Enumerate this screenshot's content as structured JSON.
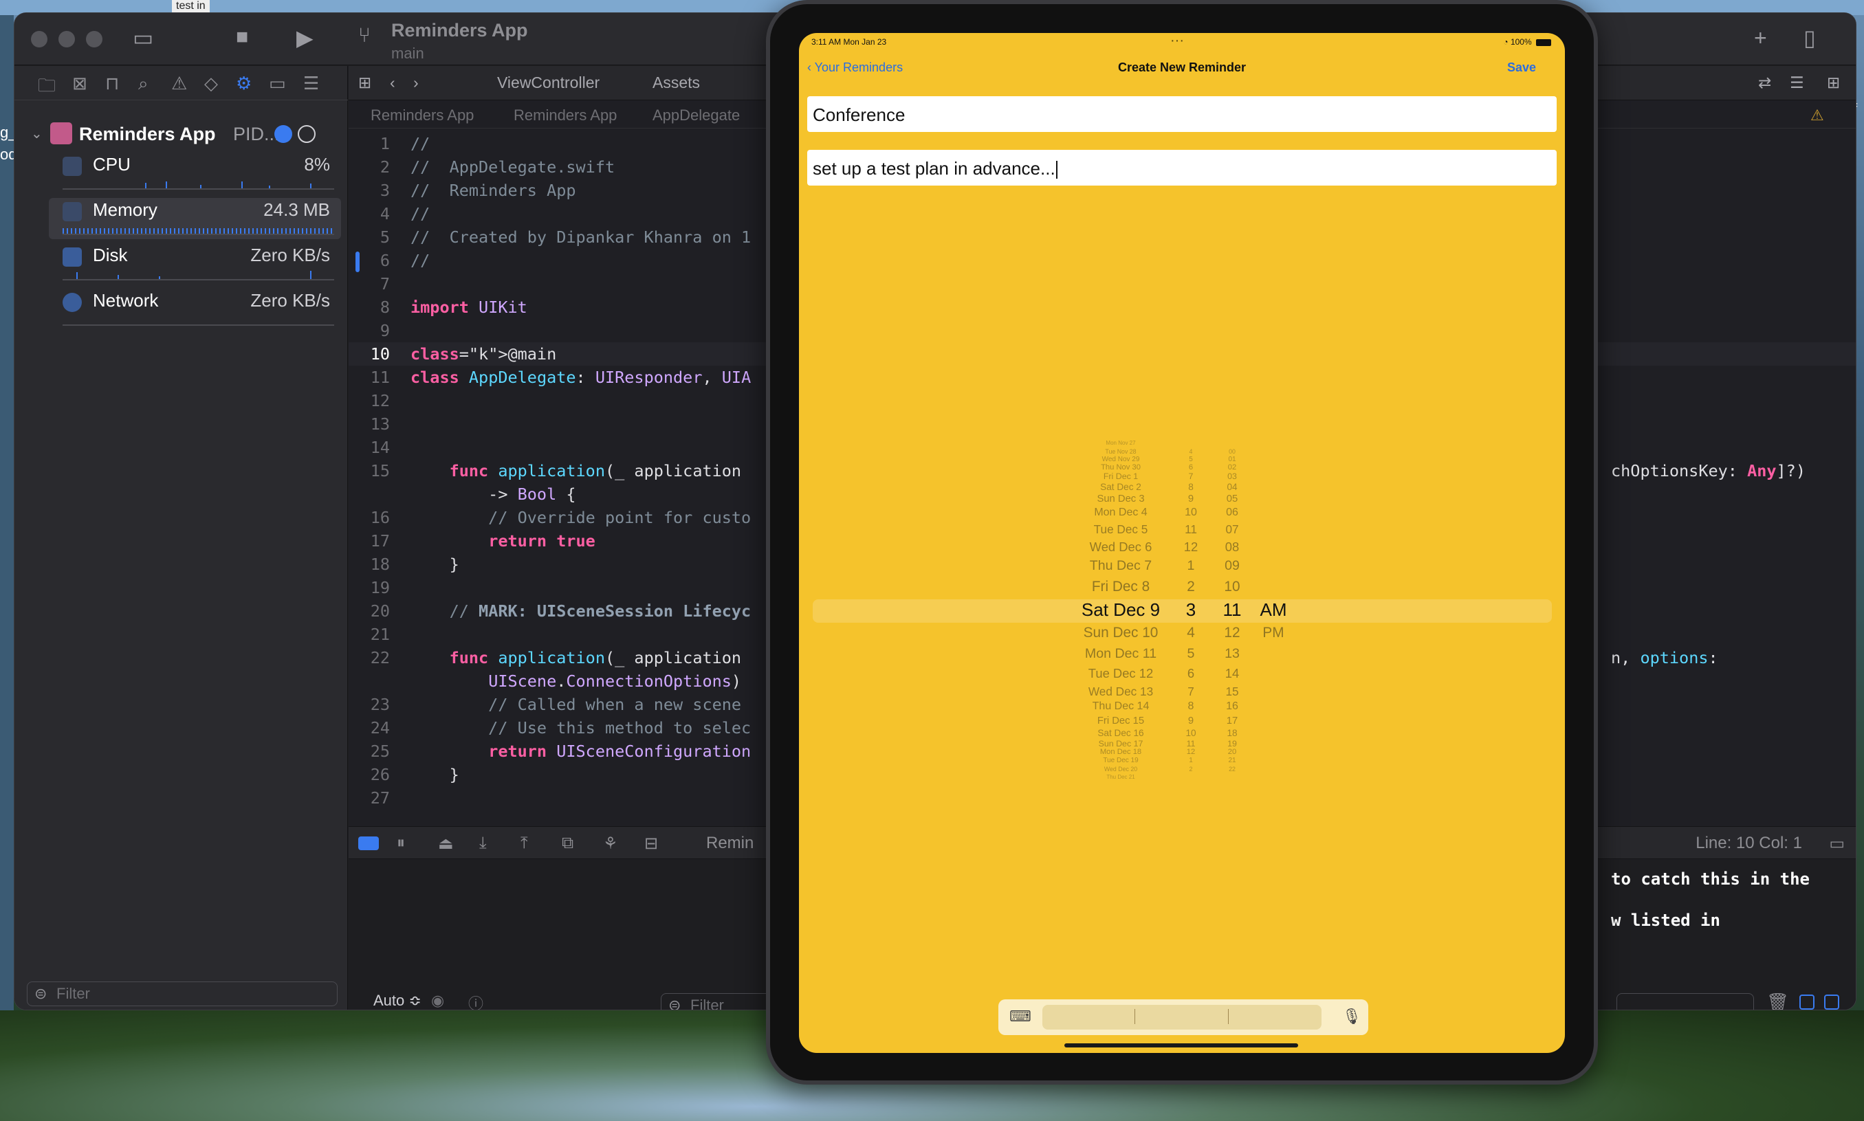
{
  "desktop": {
    "tab_text": "test in",
    "left_fragments": [
      "g_",
      "od"
    ],
    "right_fragment": "f"
  },
  "xcode": {
    "project_title": "Reminders App",
    "branch": "main",
    "jump_tabs": [
      "ViewController",
      "Assets"
    ],
    "breadcrumb": [
      "Reminders App",
      "Reminders App",
      "AppDelegate"
    ],
    "navigator": {
      "process_name": "Reminders App",
      "process_pid": "PID...",
      "gauges": [
        {
          "label": "CPU",
          "value": "8%"
        },
        {
          "label": "Memory",
          "value": "24.3 MB"
        },
        {
          "label": "Disk",
          "value": "Zero KB/s"
        },
        {
          "label": "Network",
          "value": "Zero KB/s"
        }
      ],
      "filter_placeholder": "Filter"
    },
    "code_lines": [
      {
        "n": "1",
        "text": "//"
      },
      {
        "n": "2",
        "text": "//  AppDelegate.swift"
      },
      {
        "n": "3",
        "text": "//  Reminders App"
      },
      {
        "n": "4",
        "text": "//"
      },
      {
        "n": "5",
        "text": "//  Created by Dipankar Khanra on 1"
      },
      {
        "n": "6",
        "text": "//"
      },
      {
        "n": "7",
        "text": ""
      },
      {
        "n": "8",
        "text": "import UIKit"
      },
      {
        "n": "9",
        "text": ""
      },
      {
        "n": "10",
        "text": "@main"
      },
      {
        "n": "11",
        "text": "class AppDelegate: UIResponder, UIA"
      },
      {
        "n": "12",
        "text": ""
      },
      {
        "n": "13",
        "text": ""
      },
      {
        "n": "14",
        "text": ""
      },
      {
        "n": "15",
        "text": "    func application(_ application",
        "overflow": "chOptionsKey: Any]?)"
      },
      {
        "n": "",
        "text": "        -> Bool {"
      },
      {
        "n": "16",
        "text": "        // Override point for custo"
      },
      {
        "n": "17",
        "text": "        return true"
      },
      {
        "n": "18",
        "text": "    }"
      },
      {
        "n": "19",
        "text": ""
      },
      {
        "n": "20",
        "text": "    // MARK: UISceneSession Lifecyc"
      },
      {
        "n": "21",
        "text": ""
      },
      {
        "n": "22",
        "text": "    func application(_ application",
        "overflow": "n, options:"
      },
      {
        "n": "",
        "text": "        UIScene.ConnectionOptions)"
      },
      {
        "n": "23",
        "text": "        // Called when a new scene"
      },
      {
        "n": "24",
        "text": "        // Use this method to selec"
      },
      {
        "n": "25",
        "text": "        return UISceneConfiguration"
      },
      {
        "n": "26",
        "text": "    }"
      },
      {
        "n": "27",
        "text": ""
      }
    ],
    "status": {
      "line_col": "Line: 10  Col: 1",
      "scheme_short": "Remin"
    },
    "console_lines": [
      "to catch this in the",
      "w listed in"
    ],
    "auto_label": "Auto ≎",
    "console_filter_placeholder": "Filter"
  },
  "simulator": {
    "status_time": "3:11 AM   Mon Jan 23",
    "status_battery": "100%",
    "nav": {
      "back_label": "Your Reminders",
      "title": "Create New Reminder",
      "save_label": "Save"
    },
    "title_value": "Conference",
    "notes_value": "set up a test plan in advance...",
    "picker": {
      "selected": {
        "date": "Sat Dec 9",
        "hour": "3",
        "minute": "11",
        "ampm": "AM"
      },
      "dates_above": [
        "Fri Dec 8",
        "Thu Dec 7",
        "Wed Dec 6",
        "Tue Dec 5",
        "Mon Dec 4",
        "Sun Dec 3",
        "Sat Dec 2",
        "Fri Dec 1",
        "Thu Nov 30",
        "Wed Nov 29",
        "Tue Nov 28",
        "Mon Nov 27"
      ],
      "dates_below": [
        "Sun Dec 10",
        "Mon Dec 11",
        "Tue Dec 12",
        "Wed Dec 13",
        "Thu Dec 14",
        "Fri Dec 15",
        "Sat Dec 16",
        "Sun Dec 17",
        "Mon Dec 18",
        "Tue Dec 19",
        "Wed Dec 20",
        "Thu Dec 21"
      ],
      "hours_above": [
        "2",
        "1",
        "12",
        "11",
        "10",
        "9",
        "8",
        "7",
        "6",
        "5",
        "4"
      ],
      "hours_below": [
        "4",
        "5",
        "6",
        "7",
        "8",
        "9",
        "10",
        "11",
        "12",
        "1",
        "2"
      ],
      "minutes_above": [
        "10",
        "09",
        "08",
        "07",
        "06",
        "05",
        "04",
        "03",
        "02",
        "01",
        "00"
      ],
      "minutes_below": [
        "12",
        "13",
        "14",
        "15",
        "16",
        "17",
        "18",
        "19",
        "20",
        "21",
        "22"
      ],
      "ampm_below": [
        "PM"
      ]
    }
  },
  "colors": {
    "sim_background": "#f5c32c",
    "accent_blue": "#2a6de0",
    "xcode_bg": "#1f1f24"
  }
}
